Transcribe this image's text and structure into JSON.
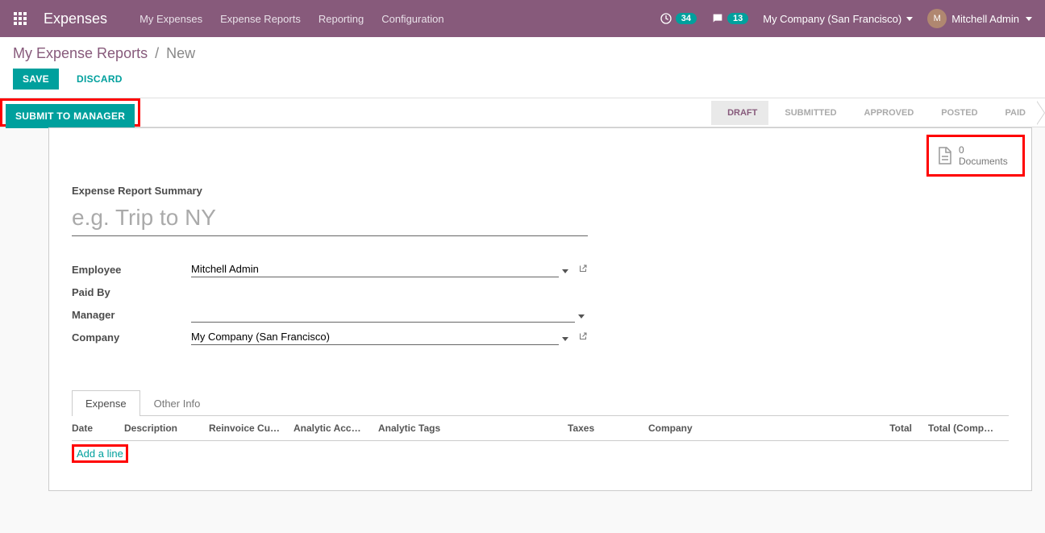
{
  "navbar": {
    "brand": "Expenses",
    "links": [
      "My Expenses",
      "Expense Reports",
      "Reporting",
      "Configuration"
    ],
    "activity_count": "34",
    "discuss_count": "13",
    "company": "My Company (San Francisco)",
    "user": "Mitchell Admin",
    "avatar_initials": "M"
  },
  "breadcrumb": {
    "parent": "My Expense Reports",
    "current": "New"
  },
  "buttons": {
    "save": "SAVE",
    "discard": "DISCARD",
    "submit": "SUBMIT TO MANAGER"
  },
  "status": {
    "steps": [
      "DRAFT",
      "SUBMITTED",
      "APPROVED",
      "POSTED",
      "PAID"
    ],
    "active": "DRAFT"
  },
  "stat_button": {
    "count": "0",
    "label": "Documents"
  },
  "form": {
    "summary_label": "Expense Report Summary",
    "title_placeholder": "e.g. Trip to NY",
    "title_value": "",
    "fields": {
      "employee_label": "Employee",
      "employee_value": "Mitchell Admin",
      "paid_by_label": "Paid By",
      "paid_by_value": "",
      "manager_label": "Manager",
      "manager_value": "",
      "company_label": "Company",
      "company_value": "My Company (San Francisco)"
    }
  },
  "tabs": {
    "items": [
      "Expense",
      "Other Info"
    ],
    "active": "Expense"
  },
  "grid": {
    "columns": {
      "date": "Date",
      "description": "Description",
      "reinvoice": "Reinvoice Cu…",
      "analytic_acc": "Analytic Acc…",
      "analytic_tags": "Analytic Tags",
      "taxes": "Taxes",
      "company": "Company",
      "total": "Total",
      "total_comp": "Total (Comp…"
    },
    "add_line": "Add a line"
  }
}
